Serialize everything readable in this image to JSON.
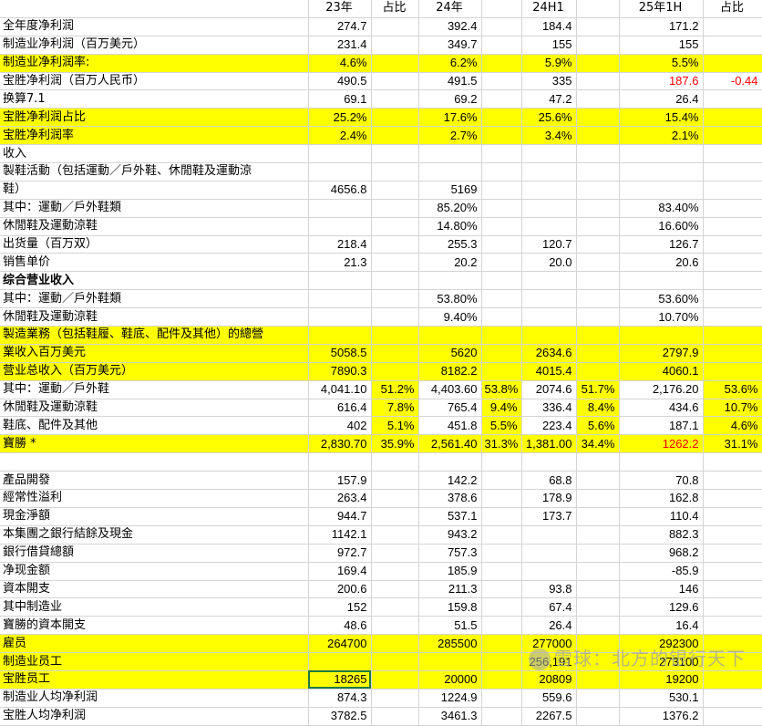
{
  "header": [
    "",
    "23年",
    "占比",
    "24年",
    "",
    "24H1",
    "",
    "25年1H",
    "占比"
  ],
  "rows": [
    {
      "c": [
        "全年度净利润",
        "274.7",
        "",
        "392.4",
        "",
        "184.4",
        "",
        "171.2",
        ""
      ],
      "y": false
    },
    {
      "c": [
        "制造业净利润（百万美元）",
        "231.4",
        "",
        "349.7",
        "",
        "155",
        "",
        "155",
        ""
      ],
      "y": false
    },
    {
      "c": [
        "制造业净利润率:",
        "4.6%",
        "",
        "6.2%",
        "",
        "5.9%",
        "",
        "5.5%",
        ""
      ],
      "y": true
    },
    {
      "c": [
        "宝胜净利润（百万人民币）",
        "490.5",
        "",
        "491.5",
        "",
        "335",
        "",
        "187.6",
        "-0.44"
      ],
      "y": false,
      "red": [
        7,
        8
      ]
    },
    {
      "c": [
        "换算7.1",
        "69.1",
        "",
        "69.2",
        "",
        "47.2",
        "",
        "26.4",
        ""
      ],
      "y": false
    },
    {
      "c": [
        "宝胜净利润占比",
        "25.2%",
        "",
        "17.6%",
        "",
        "25.6%",
        "",
        "15.4%",
        ""
      ],
      "y": true
    },
    {
      "c": [
        "宝胜净利润率",
        "2.4%",
        "",
        "2.7%",
        "",
        "3.4%",
        "",
        "2.1%",
        ""
      ],
      "y": true
    },
    {
      "c": [
        "收入",
        "",
        "",
        "",
        "",
        "",
        "",
        "",
        ""
      ],
      "y": false
    },
    {
      "c": [
        "製鞋活動（包括運動／戶外鞋、休閒鞋及運動涼",
        "",
        "",
        "",
        "",
        "",
        "",
        "",
        ""
      ],
      "y": false
    },
    {
      "c": [
        "鞋）",
        "4656.8",
        "",
        "5169",
        "",
        "",
        "",
        "",
        ""
      ],
      "y": false
    },
    {
      "c": [
        "其中：運動／戶外鞋類",
        "",
        "",
        "85.20%",
        "",
        "",
        "",
        "83.40%",
        ""
      ],
      "y": false
    },
    {
      "c": [
        "休閒鞋及運動涼鞋",
        "",
        "",
        "14.80%",
        "",
        "",
        "",
        "16.60%",
        ""
      ],
      "y": false
    },
    {
      "c": [
        "出货量（百万双）",
        "218.4",
        "",
        "255.3",
        "",
        "120.7",
        "",
        "126.7",
        ""
      ],
      "y": false
    },
    {
      "c": [
        "销售单价",
        "21.3",
        "",
        "20.2",
        "",
        "20.0",
        "",
        "20.6",
        ""
      ],
      "y": false
    },
    {
      "c": [
        "综合营业收入",
        "",
        "",
        "",
        "",
        "",
        "",
        "",
        ""
      ],
      "y": false,
      "bold": true
    },
    {
      "c": [
        "其中：運動／戶外鞋類",
        "",
        "",
        "53.80%",
        "",
        "",
        "",
        "53.60%",
        ""
      ],
      "y": false
    },
    {
      "c": [
        "休閒鞋及運動涼鞋",
        "",
        "",
        "9.40%",
        "",
        "",
        "",
        "10.70%",
        ""
      ],
      "y": false
    },
    {
      "c": [
        "製造業務（包括鞋履、鞋底、配件及其他）的總營",
        "",
        "",
        "",
        "",
        "",
        "",
        "",
        ""
      ],
      "y": true
    },
    {
      "c": [
        "業收入百万美元",
        "5058.5",
        "",
        "5620",
        "",
        "2634.6",
        "",
        "2797.9",
        ""
      ],
      "y": true
    },
    {
      "c": [
        "营业总收入（百万美元）",
        "7890.3",
        "",
        "8182.2",
        "",
        "4015.4",
        "",
        "4060.1",
        ""
      ],
      "y": true
    },
    {
      "c": [
        "其中：運動／戶外鞋",
        "4,041.10",
        "51.2%",
        "4,403.60",
        "53.8%",
        "2074.6",
        "51.7%",
        "2,176.20",
        "53.6%"
      ],
      "y": false,
      "ycols": [
        2,
        4,
        6,
        8
      ]
    },
    {
      "c": [
        "休閒鞋及運動涼鞋",
        "616.4",
        "7.8%",
        "765.4",
        "9.4%",
        "336.4",
        "8.4%",
        "434.6",
        "10.7%"
      ],
      "y": false,
      "ycols": [
        2,
        4,
        6,
        8
      ]
    },
    {
      "c": [
        "鞋底、配件及其他",
        "402",
        "5.1%",
        "451.8",
        "5.5%",
        "223.4",
        "5.6%",
        "187.1",
        "4.6%"
      ],
      "y": false,
      "ycols": [
        2,
        4,
        6,
        8
      ]
    },
    {
      "c": [
        "寶勝 *",
        "2,830.70",
        "35.9%",
        "2,561.40",
        "31.3%",
        "1,381.00",
        "34.4%",
        "1262.2",
        "31.1%"
      ],
      "y": true,
      "red": [
        7
      ]
    },
    {
      "c": [
        "",
        "",
        "",
        "",
        "",
        "",
        "",
        "",
        ""
      ],
      "y": false
    },
    {
      "c": [
        "產品開發",
        "157.9",
        "",
        "142.2",
        "",
        "68.8",
        "",
        "70.8",
        ""
      ],
      "y": false
    },
    {
      "c": [
        "經常性溢利",
        "263.4",
        "",
        "378.6",
        "",
        "178.9",
        "",
        "162.8",
        ""
      ],
      "y": false
    },
    {
      "c": [
        "現金淨額",
        "944.7",
        "",
        "537.1",
        "",
        "173.7",
        "",
        "110.4",
        ""
      ],
      "y": false
    },
    {
      "c": [
        "本集團之銀行結餘及現金",
        "1142.1",
        "",
        "943.2",
        "",
        "",
        "",
        "882.3",
        ""
      ],
      "y": false
    },
    {
      "c": [
        "銀行借貸總額",
        "972.7",
        "",
        "757.3",
        "",
        "",
        "",
        "968.2",
        ""
      ],
      "y": false
    },
    {
      "c": [
        "净现金额",
        "169.4",
        "",
        "185.9",
        "",
        "",
        "",
        "-85.9",
        ""
      ],
      "y": false
    },
    {
      "c": [
        "資本開支",
        "200.6",
        "",
        "211.3",
        "",
        "93.8",
        "",
        "146",
        ""
      ],
      "y": false
    },
    {
      "c": [
        "其中制造业",
        "152",
        "",
        "159.8",
        "",
        "67.4",
        "",
        "129.6",
        ""
      ],
      "y": false
    },
    {
      "c": [
        "寶勝的資本開支",
        "48.6",
        "",
        "51.5",
        "",
        "26.4",
        "",
        "16.4",
        ""
      ],
      "y": false
    },
    {
      "c": [
        "雇员",
        "264700",
        "",
        "285500",
        "",
        "277000",
        "",
        "292300",
        ""
      ],
      "y": true
    },
    {
      "c": [
        "制造业员工",
        "",
        "",
        "",
        "",
        "256,191",
        "",
        "273100",
        ""
      ],
      "y": true
    },
    {
      "c": [
        "宝胜员工",
        "18265",
        "",
        "20000",
        "",
        "20809",
        "",
        "19200",
        ""
      ],
      "y": true,
      "sel": 1
    },
    {
      "c": [
        "制造业人均净利润",
        "874.3",
        "",
        "1224.9",
        "",
        "559.6",
        "",
        "530.1",
        ""
      ],
      "y": false
    },
    {
      "c": [
        "宝胜人均净利润",
        "3782.5",
        "",
        "3461.3",
        "",
        "2267.5",
        "",
        "1376.2",
        ""
      ],
      "y": false
    }
  ],
  "watermark": "雪球：北方的银行天下"
}
